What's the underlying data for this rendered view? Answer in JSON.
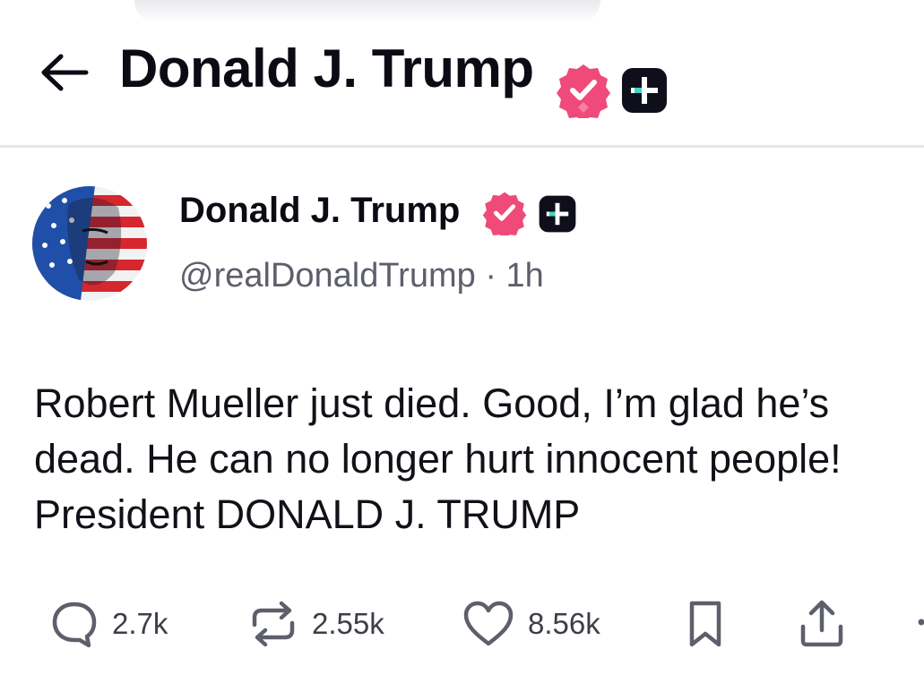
{
  "header": {
    "title": "Donald J. Trump"
  },
  "post": {
    "author_name": "Donald J. Trump",
    "handle": "@realDonaldTrump",
    "separator": "·",
    "time": "1h",
    "text": "Robert Mueller just died. Good, I’m glad he’s dead. He can no longer hurt innocent people! President DONALD J. TRUMP"
  },
  "actions": {
    "reply_count": "2.7k",
    "repost_count": "2.55k",
    "like_count": "8.56k"
  },
  "colors": {
    "verified_badge": "#ef4a7a",
    "plus_badge_bg": "#0f0f1c",
    "plus_badge_accent": "#3fd6c5",
    "icon_gray": "#5d5f6b"
  },
  "icons": {
    "back": "arrow-left-icon",
    "verified": "verified-badge-icon",
    "plus": "plus-badge-icon",
    "reply": "comment-bubble-icon",
    "repost": "repost-icon",
    "like": "heart-icon",
    "bookmark": "bookmark-icon",
    "share": "share-upload-icon"
  }
}
